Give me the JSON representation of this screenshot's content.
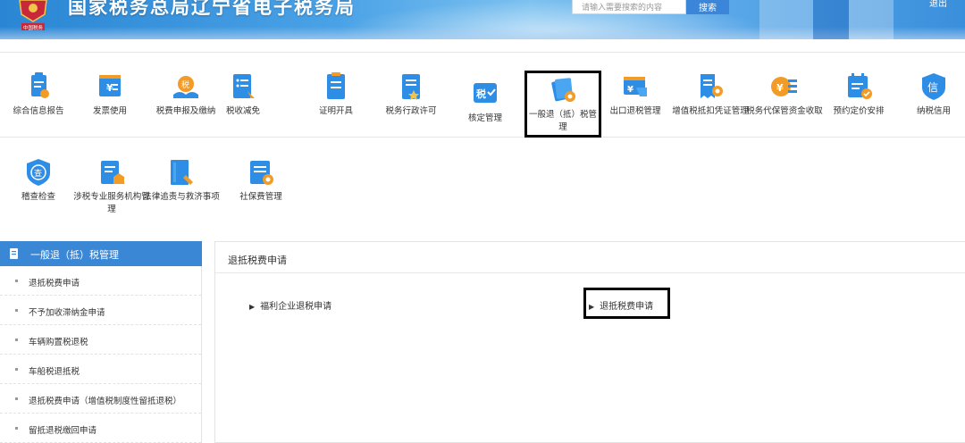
{
  "header": {
    "logo_text": "中国税务",
    "title": "国家税务总局辽宁省电子税务局",
    "search_placeholder": "请输入需要搜索的内容",
    "search_button": "搜索",
    "logout": "退出"
  },
  "nav": {
    "row1": [
      {
        "label": "综合信息报告",
        "icon": "report-icon"
      },
      {
        "label": "发票使用",
        "icon": "invoice-icon"
      },
      {
        "label": "税费申报及缴纳",
        "icon": "tax-declare-icon"
      },
      {
        "label": "税收减免",
        "icon": "tax-relief-icon"
      },
      {
        "label": "证明开具",
        "icon": "certificate-icon"
      },
      {
        "label": "税务行政许可",
        "icon": "permit-icon"
      },
      {
        "label": "核定管理",
        "icon": "assessment-icon"
      },
      {
        "label": "一般退（抵）税管理",
        "icon": "refund-icon",
        "selected": true
      },
      {
        "label": "出口退税管理",
        "icon": "export-refund-icon"
      },
      {
        "label": "增值税抵扣凭证管理",
        "icon": "vat-voucher-icon"
      },
      {
        "label": "税务代保管资金收取",
        "icon": "fund-custody-icon"
      },
      {
        "label": "预约定价安排",
        "icon": "pricing-icon"
      },
      {
        "label": "纳税信用",
        "icon": "credit-icon"
      }
    ],
    "row2": [
      {
        "label": "稽查检查",
        "icon": "audit-icon"
      },
      {
        "label": "涉税专业服务机构管理",
        "icon": "agency-icon"
      },
      {
        "label": "法律追责与救济事项",
        "icon": "legal-icon"
      },
      {
        "label": "社保费管理",
        "icon": "social-security-icon"
      }
    ]
  },
  "sidebar": {
    "title": "一般退（抵）税管理",
    "items": [
      {
        "label": "退抵税费申请"
      },
      {
        "label": "不予加收滞纳金申请"
      },
      {
        "label": "车辆购置税退税"
      },
      {
        "label": "车船税退抵税"
      },
      {
        "label": "退抵税费申请（增值税制度性留抵退税）"
      },
      {
        "label": "留抵退税缴回申请"
      }
    ]
  },
  "main": {
    "title": "退抵税费申请",
    "links": [
      {
        "label": "福利企业退税申请"
      },
      {
        "label": "退抵税费申请"
      }
    ]
  },
  "colors": {
    "brand_blue": "#3a87d6",
    "header_blue": "#4aa2e6",
    "highlight_border": "#000000"
  }
}
